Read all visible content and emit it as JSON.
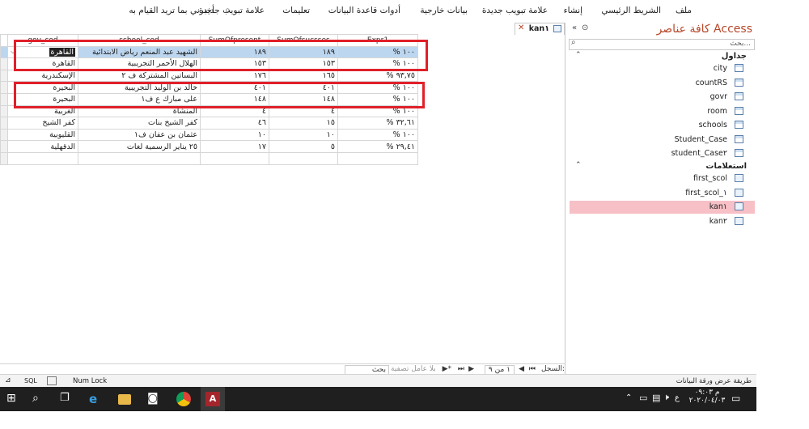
{
  "ribbon": {
    "tabs": [
      "ملف",
      "الشريط الرئيسي",
      "إنشاء",
      "علامة تبويب جديدة",
      "بيانات خارجية",
      "أدوات قاعدة البيانات",
      "تعليمات",
      "علامة تبويب جديدة"
    ],
    "tell_me": "أخبرني بما تريد القيام به"
  },
  "nav": {
    "title": "كافة عناصر Access",
    "search_placeholder": "بحث...",
    "tables_header": "جداول",
    "tables": [
      "city",
      "countRS",
      "govr",
      "room",
      "schools",
      "Student_Case",
      "student_Case٢"
    ],
    "queries_header": "استعلامات",
    "queries": [
      "first_scol",
      "first_scol_١",
      "kan١",
      "kan٢"
    ],
    "selected_query": "kan١"
  },
  "doc_tab": {
    "label": "kan١"
  },
  "grid": {
    "columns": [
      "gov_cod",
      "school_cod",
      "SumOfpresent",
      "SumOfsucsses",
      "Expr1"
    ],
    "rows": [
      [
        "القاهرة",
        "الشهيد عبد المنعم رياض الابتدائية",
        "١٨٩",
        "١٨٩",
        "% ١٠٠"
      ],
      [
        "القاهرة",
        "الهلال الأحمر التجريبية",
        "١٥٣",
        "١٥٣",
        "% ١٠٠"
      ],
      [
        "الإسكندرية",
        "البساتين المشتركة ف ٢",
        "١٧٦",
        "١٦٥",
        "% ٩٣,٧٥"
      ],
      [
        "البحيرة",
        "خالد بن الوليد التجريبية",
        "٤٠١",
        "٤٠١",
        "% ١٠٠"
      ],
      [
        "البحيرة",
        "على مبارك ع ف١",
        "١٤٨",
        "١٤٨",
        "% ١٠٠"
      ],
      [
        "الغربية",
        "المنشاة",
        "٤",
        "٤",
        "% ١٠٠"
      ],
      [
        "كفر الشيخ",
        "كفر الشيخ بنات",
        "٤٦",
        "١٥",
        "% ٣٢,٦١"
      ],
      [
        "القليوبية",
        "عثمان بن عفان ف١",
        "١٠",
        "١٠",
        "% ١٠٠"
      ],
      [
        "الدقهلية",
        "٢٥ يناير الرسمية لغات",
        "١٧",
        "٥",
        "% ٢٩,٤١"
      ]
    ]
  },
  "recbar": {
    "record_label": "السجل:",
    "record_pos": "١ من ٩",
    "filter": "بلا عامل تصفية",
    "search": "بحث"
  },
  "status": {
    "left_text": "طريقة عرض ورقة البيانات",
    "numlock": "Num Lock",
    "sql": "SQL"
  },
  "taskbar": {
    "time": "م ٠٩:٠٣",
    "date": "٢٠٢٠/٠٤/٠٣",
    "lang": "ع"
  },
  "colors": {
    "accent": "#b7472a",
    "selection": "#f7c0c6",
    "highlight_box": "#e0202a"
  }
}
